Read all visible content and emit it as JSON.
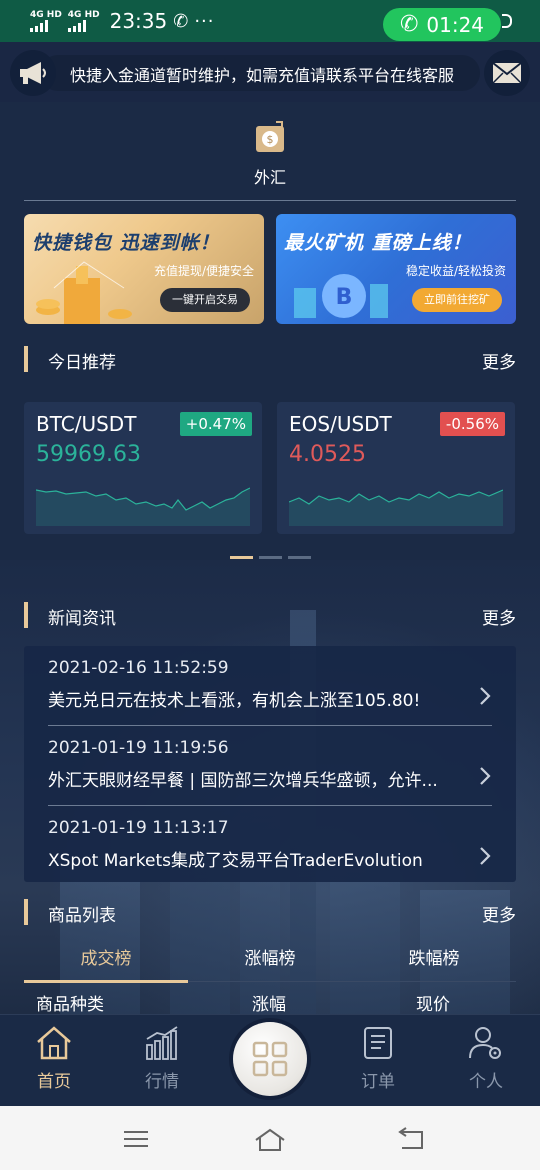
{
  "status_bar": {
    "signal_1": "4G HD",
    "signal_2": "4G HD",
    "time": "23:35",
    "call_timer": "01:24"
  },
  "notice": {
    "text": "快捷入金通道暂时维护，如需充值请联系平台在线客服"
  },
  "forex": {
    "label": "外汇"
  },
  "banners": [
    {
      "title": "快捷钱包 迅速到帐！",
      "subtitle": "充值提现/便捷安全",
      "button": "一键开启交易"
    },
    {
      "title": "最火矿机 重磅上线！",
      "subtitle": "稳定收益/轻松投资",
      "button": "立即前往挖矿"
    }
  ],
  "recommend": {
    "title": "今日推荐",
    "more": "更多",
    "cards": [
      {
        "pair": "BTC/USDT",
        "change": "+0.47%",
        "price": "59969.63",
        "direction": "up"
      },
      {
        "pair": "EOS/USDT",
        "change": "-0.56%",
        "price": "4.0525",
        "direction": "down"
      }
    ]
  },
  "news": {
    "title": "新闻资讯",
    "more": "更多",
    "items": [
      {
        "date": "2021-02-16 11:52:59",
        "title": "美元兑日元在技术上看涨，有机会上涨至105.80!"
      },
      {
        "date": "2021-01-19 11:19:56",
        "title": "外汇天眼财经早餐 | 国防部三次增兵华盛顿，允许..."
      },
      {
        "date": "2021-01-19 11:13:17",
        "title": "XSpot Markets集成了交易平台TraderEvolution"
      }
    ]
  },
  "products": {
    "title": "商品列表",
    "more": "更多",
    "tabs": [
      "成交榜",
      "涨幅榜",
      "跌幅榜"
    ],
    "columns": [
      "商品种类",
      "涨幅",
      "现价"
    ]
  },
  "bottom_nav": {
    "items": [
      "首页",
      "行情",
      "订单",
      "个人"
    ]
  },
  "colors": {
    "accent": "#e8c99a",
    "up": "#2bb39a",
    "down": "#e05a5a",
    "background": "#1b2a45"
  }
}
